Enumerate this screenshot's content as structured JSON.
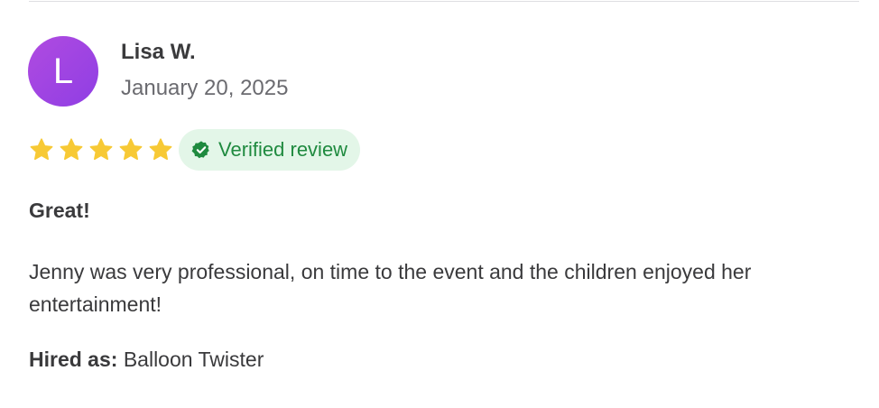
{
  "review": {
    "avatar_initial": "L",
    "reviewer_name": "Lisa W.",
    "date": "January 20, 2025",
    "rating": 5,
    "rating_max": 5,
    "badge_icon": "verified-badge-icon",
    "badge_label": "Verified review",
    "title": "Great!",
    "body": "Jenny was very professional, on time to the event and the children enjoyed her entertainment!",
    "hired_label": "Hired as:",
    "hired_value": "Balloon Twister"
  },
  "colors": {
    "avatar": "#9b45e2",
    "star": "#f7c935",
    "badge_bg": "#e3f6e8",
    "badge_text": "#1f8a3f"
  }
}
